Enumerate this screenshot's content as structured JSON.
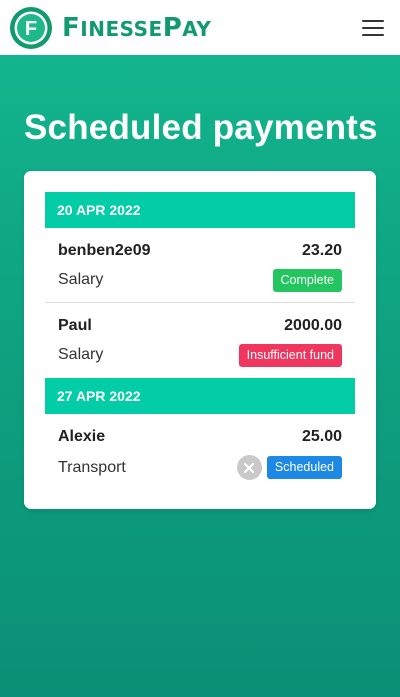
{
  "header": {
    "brand_cap1": "F",
    "brand_rest1": "INESSE",
    "brand_cap2": "P",
    "brand_rest2": "AY",
    "logo_letter": "F",
    "menu_icon": "hamburger-menu-icon"
  },
  "page": {
    "title": "Scheduled payments"
  },
  "groups": [
    {
      "date": "20 APR 2022",
      "payments": [
        {
          "name": "benben2e09",
          "amount": "23.20",
          "category": "Salary",
          "status": "Complete",
          "status_color": "#22c55e"
        },
        {
          "name": "Paul",
          "amount": "2000.00",
          "category": "Salary",
          "status": "Insufficient fund",
          "status_color": "#f0365f"
        }
      ]
    },
    {
      "date": "27 APR 2022",
      "payments": [
        {
          "name": "Alexie",
          "amount": "25.00",
          "category": "Transport",
          "status": "Scheduled",
          "status_color": "#1e88e5",
          "cancel_icon": "close-circle-icon"
        }
      ]
    }
  ],
  "colors": {
    "brand": "#109a6e",
    "header_bar": "#03cda7",
    "background_top": "#12b58d",
    "background_bottom": "#0b8f76"
  }
}
